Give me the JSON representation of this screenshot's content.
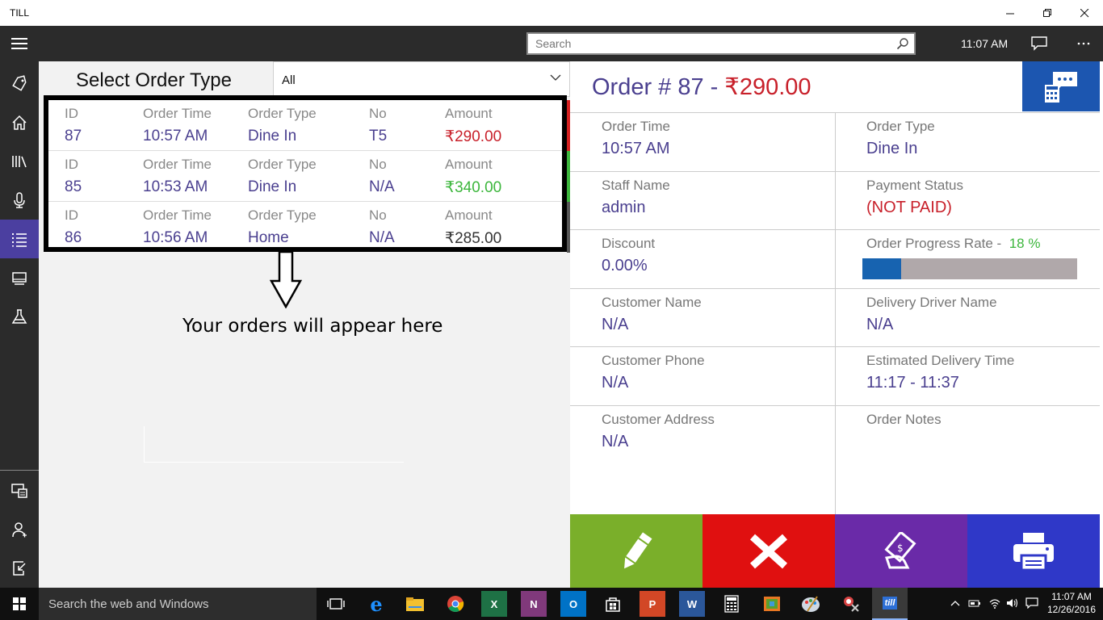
{
  "window": {
    "title": "TILL"
  },
  "header": {
    "search_placeholder": "Search",
    "time": "11:07 AM"
  },
  "left": {
    "select_label": "Select Order Type",
    "select_value": "All",
    "hint": "Your orders will appear here",
    "col_labels": {
      "id": "ID",
      "time": "Order Time",
      "type": "Order Type",
      "no": "No",
      "amount": "Amount"
    },
    "orders": [
      {
        "id": "87",
        "time": "10:57 AM",
        "type": "Dine In",
        "no": "T5",
        "amount": "₹290.00",
        "amount_color": "#c8202a",
        "strip_color": "#d32020"
      },
      {
        "id": "85",
        "time": "10:53 AM",
        "type": "Dine In",
        "no": "N/A",
        "amount": "₹340.00",
        "amount_color": "#3cb63c",
        "strip_color": "#3cb63c"
      },
      {
        "id": "86",
        "time": "10:56 AM",
        "type": "Home",
        "no": "N/A",
        "amount": "₹285.00",
        "amount_color": "#333333",
        "strip_color": "#555555"
      }
    ]
  },
  "detail": {
    "title_prefix": "Order # 87 - ",
    "title_amount": "₹290.00",
    "fields": {
      "order_time_label": "Order Time",
      "order_time": "10:57 AM",
      "order_type_label": "Order Type",
      "order_type": "Dine In",
      "staff_label": "Staff Name",
      "staff": "admin",
      "payment_label": "Payment Status",
      "payment": "(NOT PAID)",
      "discount_label": "Discount",
      "discount": "0.00%",
      "progress_label": "Order Progress Rate -",
      "progress_text": "18 %",
      "progress_value": 18,
      "customer_name_label": "Customer Name",
      "customer_name": "N/A",
      "driver_label": "Delivery Driver Name",
      "driver": "N/A",
      "customer_phone_label": "Customer Phone",
      "customer_phone": "N/A",
      "eta_label": "Estimated Delivery Time",
      "eta": "11:17  -  11:37",
      "customer_address_label": "Customer Address",
      "customer_address": "N/A",
      "notes_label": "Order Notes"
    },
    "action_colors": {
      "edit": "#7aaf2a",
      "cancel": "#e01010",
      "pay": "#6a2aa8",
      "print": "#2f38c8"
    }
  },
  "taskbar": {
    "search_text": "Search the web and Windows",
    "time": "11:07 AM",
    "date": "12/26/2016"
  }
}
